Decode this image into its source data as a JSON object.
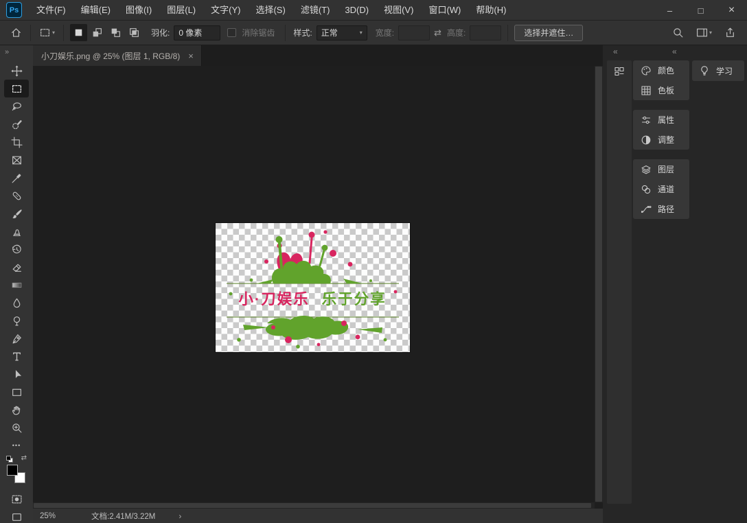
{
  "app": {
    "logo_text": "Ps",
    "window_controls": {
      "minimize": "–",
      "maximize": "□",
      "close": "×"
    }
  },
  "colors": {
    "logo_blue": "#31a8ff",
    "panel_background": "#373737",
    "canvas_background": "#1e1e1e",
    "artwork_red": "#d8255f",
    "artwork_green": "#61a32c"
  },
  "menu_bar": {
    "items": [
      "文件(F)",
      "编辑(E)",
      "图像(I)",
      "图层(L)",
      "文字(Y)",
      "选择(S)",
      "滤镜(T)",
      "3D(D)",
      "视图(V)",
      "窗口(W)",
      "帮助(H)"
    ]
  },
  "options_bar": {
    "feather_label": "羽化:",
    "feather_value": "0 像素",
    "antialias_label": "消除锯齿",
    "style_label": "样式:",
    "style_value": "正常",
    "width_label": "宽度:",
    "width_value": "",
    "height_label": "高度:",
    "height_value": "",
    "select_and_mask_label": "选择并遮住…",
    "dropdown_arrow": "▾",
    "swap_glyph": "⇄"
  },
  "document_tab": {
    "title": "小刀娱乐.png @ 25% (图层 1, RGB/8)",
    "close_glyph": "×"
  },
  "left_toolbar": {
    "expand_glyph": "»",
    "more_tools_glyph": "•••"
  },
  "right_dock": {
    "collapse_glyph": "«",
    "panels": {
      "color": "颜色",
      "swatches": "色板",
      "properties": "属性",
      "adjustments": "调整",
      "layers": "图层",
      "channels": "通道",
      "paths": "路径",
      "learn": "学习"
    }
  },
  "status_bar": {
    "zoom_value": "25%",
    "document_info": "文档:2.41M/3.22M",
    "expand_glyph": "›"
  },
  "artwork": {
    "text_left": "小·刀娱乐",
    "text_right": "乐于分享"
  },
  "icons": {
    "home-icon": "house outline",
    "tool-preset-icon": "dashed square + dropdown",
    "new-selection-icon": "solid square",
    "add-selection-icon": "two squares",
    "subtract-selection-icon": "two squares offset",
    "intersect-selection-icon": "overlapping squares",
    "search-icon": "magnifier",
    "workspace-icon": "panel layout",
    "share-icon": "box with up arrow",
    "move-tool-icon": "four-way arrow",
    "marquee-tool-icon": "dashed rectangle",
    "lasso-tool-icon": "lasso loop",
    "quick-selection-tool-icon": "brush with dashed circle",
    "crop-tool-icon": "crop corners",
    "frame-tool-icon": "rectangle with X",
    "eyedropper-tool-icon": "eyedropper",
    "healing-brush-tool-icon": "bandage",
    "brush-tool-icon": "paint brush",
    "clone-stamp-tool-icon": "stamp",
    "history-brush-tool-icon": "clock arrow",
    "eraser-tool-icon": "eraser block",
    "gradient-tool-icon": "gradient bar",
    "blur-tool-icon": "water drop",
    "dodge-tool-icon": "lollipop",
    "pen-tool-icon": "pen nib",
    "type-tool-icon": "letter T",
    "path-selection-tool-icon": "cursor arrow",
    "rectangle-tool-icon": "rectangle outline",
    "hand-tool-icon": "hand",
    "zoom-tool-icon": "magnifier plus",
    "quick-mask-icon": "circle in dashed rect",
    "screen-mode-icon": "rectangle",
    "color-panel-icon": "palette",
    "swatches-panel-icon": "grid",
    "properties-panel-icon": "sliders",
    "adjustments-panel-icon": "half circle",
    "layers-panel-icon": "stacked layers",
    "channels-panel-icon": "overlapping circles",
    "paths-panel-icon": "curve with anchors",
    "learn-panel-icon": "lightbulb",
    "collapsed-panel-icon": "small panels"
  }
}
